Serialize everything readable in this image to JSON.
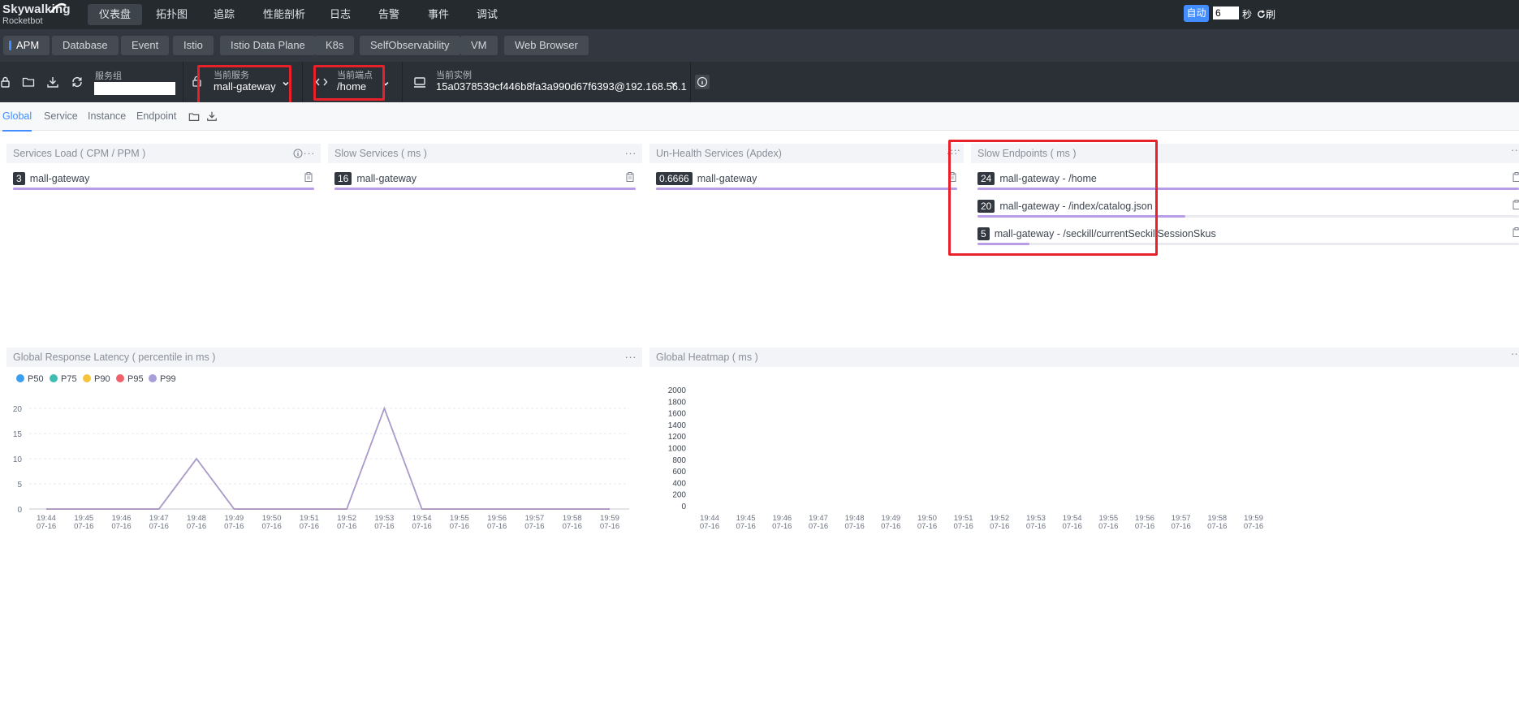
{
  "brand": {
    "line1": "Skywalking",
    "line2": "Rocketbot"
  },
  "nav": [
    "仪表盘",
    "拓扑图",
    "追踪",
    "性能剖析",
    "日志",
    "告警",
    "事件",
    "调试"
  ],
  "nav_active": 0,
  "auto": {
    "label": "自动",
    "seconds": "6",
    "unit": "秒",
    "refresh": "刷"
  },
  "layer_tabs": [
    "APM",
    "Database",
    "Event",
    "Istio",
    "Istio Data Plane",
    "K8s",
    "SelfObservability",
    "VM",
    "Web Browser"
  ],
  "selectors": {
    "group": {
      "label": "服务组",
      "value": ""
    },
    "service": {
      "label": "当前服务",
      "value": "mall-gateway"
    },
    "endpoint": {
      "label": "当前端点",
      "value": "/home"
    },
    "instance": {
      "label": "当前实例",
      "value": "15a0378539cf446b8fa3a990d67f6393@192.168.56.1"
    }
  },
  "sub_tabs": [
    "Global",
    "Service",
    "Instance",
    "Endpoint"
  ],
  "panels": {
    "services_load": {
      "title": "Services Load ( CPM / PPM )",
      "rows": [
        {
          "value": "3",
          "name": "mall-gateway",
          "ratio": 1.0
        }
      ]
    },
    "slow_services": {
      "title": "Slow Services ( ms )",
      "rows": [
        {
          "value": "16",
          "name": "mall-gateway",
          "ratio": 1.0
        }
      ]
    },
    "unhealth_services": {
      "title": "Un-Health Services (Apdex)",
      "rows": [
        {
          "value": "0.6666",
          "name": "mall-gateway",
          "ratio": 1.0
        }
      ]
    },
    "slow_endpoints": {
      "title": "Slow Endpoints ( ms )",
      "rows": [
        {
          "value": "24",
          "name": "mall-gateway - /home",
          "ratio": 1.0
        },
        {
          "value": "20",
          "name": "mall-gateway - /index/catalog.json",
          "ratio": 0.833
        },
        {
          "value": "5",
          "name": "mall-gateway - /seckill/currentSeckillSessionSkus",
          "ratio": 0.208
        }
      ]
    },
    "latency": {
      "title": "Global Response Latency ( percentile in ms )"
    },
    "heatmap": {
      "title": "Global Heatmap ( ms )"
    }
  },
  "chart_data": [
    {
      "type": "line",
      "title": "Global Response Latency ( percentile in ms )",
      "x": [
        "19:44\n07-16",
        "19:45\n07-16",
        "19:46\n07-16",
        "19:47\n07-16",
        "19:48\n07-16",
        "19:49\n07-16",
        "19:50\n07-16",
        "19:51\n07-16",
        "19:52\n07-16",
        "19:53\n07-16",
        "19:54\n07-16",
        "19:55\n07-16",
        "19:56\n07-16",
        "19:57\n07-16",
        "19:58\n07-16",
        "19:59\n07-16"
      ],
      "ylim": [
        0,
        20
      ],
      "yticks": [
        0,
        5,
        10,
        15,
        20
      ],
      "grid": true,
      "legend_position": "top-left",
      "series": [
        {
          "name": "P50",
          "color": "#3a9ff0",
          "values": [
            0,
            0,
            0,
            0,
            10,
            0,
            0,
            0,
            0,
            20,
            0,
            0,
            0,
            0,
            0,
            0
          ]
        },
        {
          "name": "P75",
          "color": "#3fbdb1",
          "values": [
            0,
            0,
            0,
            0,
            10,
            0,
            0,
            0,
            0,
            20,
            0,
            0,
            0,
            0,
            0,
            0
          ]
        },
        {
          "name": "P90",
          "color": "#f6c43c",
          "values": [
            0,
            0,
            0,
            0,
            10,
            0,
            0,
            0,
            0,
            20,
            0,
            0,
            0,
            0,
            0,
            0
          ]
        },
        {
          "name": "P95",
          "color": "#f0606b",
          "values": [
            0,
            0,
            0,
            0,
            10,
            0,
            0,
            0,
            0,
            20,
            0,
            0,
            0,
            0,
            0,
            0
          ]
        },
        {
          "name": "P99",
          "color": "#a59ed9",
          "values": [
            0,
            0,
            0,
            0,
            10,
            0,
            0,
            0,
            0,
            20,
            0,
            0,
            0,
            0,
            0,
            0
          ]
        }
      ]
    },
    {
      "type": "heatmap",
      "title": "Global Heatmap ( ms )",
      "x": [
        "19:44\n07-16",
        "19:45\n07-16",
        "19:46\n07-16",
        "19:47\n07-16",
        "19:48\n07-16",
        "19:49\n07-16",
        "19:50\n07-16",
        "19:51\n07-16",
        "19:52\n07-16",
        "19:53\n07-16",
        "19:54\n07-16",
        "19:55\n07-16",
        "19:56\n07-16",
        "19:57\n07-16",
        "19:58\n07-16",
        "19:59\n07-16"
      ],
      "y": [
        0,
        200,
        400,
        600,
        800,
        1000,
        1200,
        1400,
        1600,
        1800,
        2000
      ],
      "values": []
    }
  ]
}
